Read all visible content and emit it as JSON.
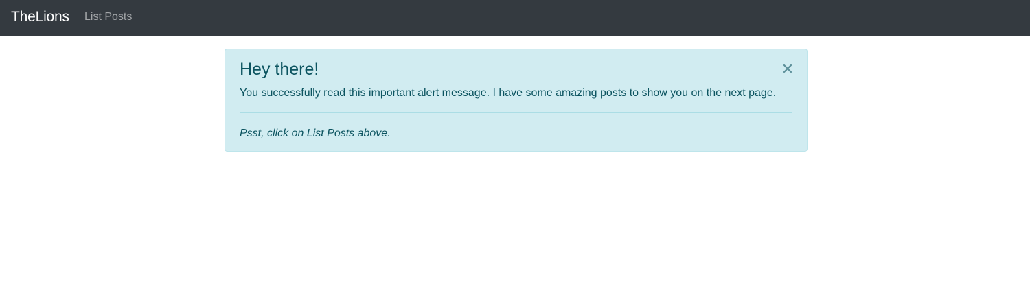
{
  "navbar": {
    "brand": "TheLions",
    "links": [
      {
        "label": "List Posts"
      }
    ]
  },
  "alert": {
    "heading": "Hey there!",
    "message": "You successfully read this important alert message. I have some amazing posts to show you on the next page.",
    "footnote": "Psst, click on List Posts above.",
    "close_icon": "close-icon"
  },
  "colors": {
    "navbar_bg": "#343a40",
    "alert_bg": "#d1ecf1",
    "alert_border": "#bee5eb",
    "alert_text": "#0c5460"
  }
}
